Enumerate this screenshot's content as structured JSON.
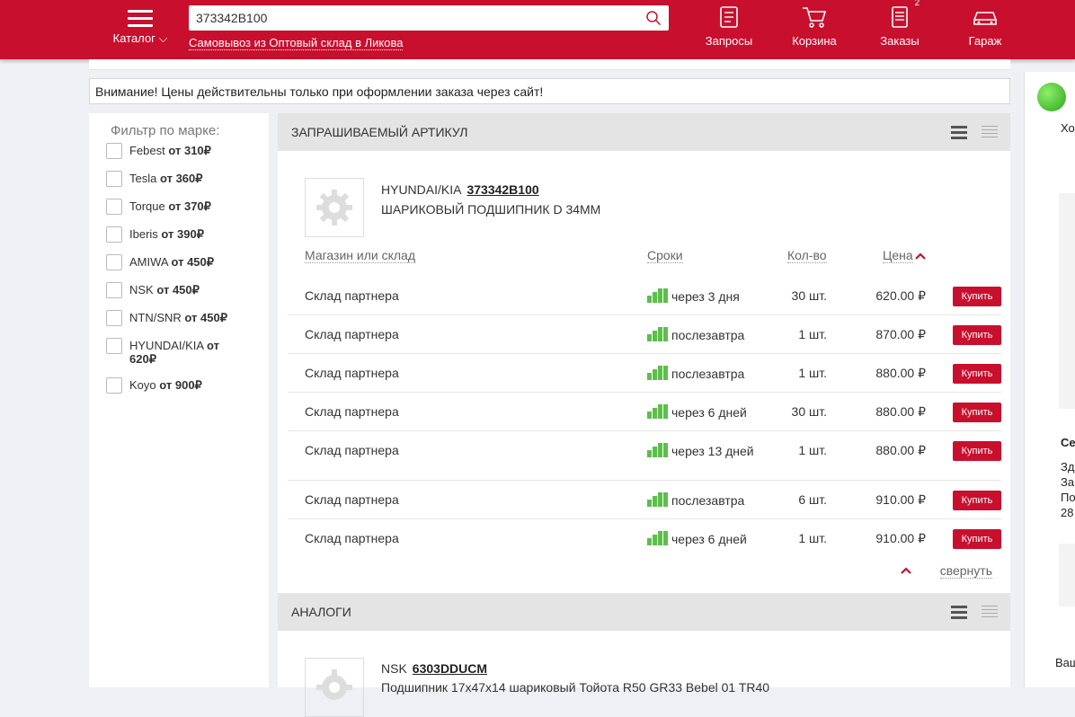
{
  "header": {
    "catalog_label": "Каталог ⌵",
    "search_value": "373342B100",
    "pickup": "Самовывоз из Оптовый склад в Ликова",
    "nav": [
      {
        "label": "Запросы",
        "icon": "checklist-icon"
      },
      {
        "label": "Корзина",
        "icon": "cart-icon"
      },
      {
        "label": "Заказы",
        "icon": "orders-icon",
        "badge": "2"
      },
      {
        "label": "Гараж",
        "icon": "car-icon"
      }
    ]
  },
  "notice": "Внимание! Цены действительны только при оформлении заказа через сайт!",
  "filter": {
    "title": "Фильтр по марке:",
    "brands": [
      {
        "name": "Febest",
        "price": "от 310₽"
      },
      {
        "name": "Tesla",
        "price": "от 360₽"
      },
      {
        "name": "Torque",
        "price": "от 370₽"
      },
      {
        "name": "Iberis",
        "price": "от 390₽"
      },
      {
        "name": "AMIWA",
        "price": "от 450₽"
      },
      {
        "name": "NSK",
        "price": "от 450₽"
      },
      {
        "name": "NTN/SNR",
        "price": "от 450₽"
      },
      {
        "name": "HYUNDAI/KIA",
        "price": "от 620₽"
      },
      {
        "name": "Koyo",
        "price": "от 900₽"
      }
    ]
  },
  "requested": {
    "title": "ЗАПРАШИВАЕМЫЙ АРТИКУЛ",
    "brand": "HYUNDAI/KIA",
    "article": "373342B100",
    "description": "ШАРИКОВЫЙ ПОДШИПНИК D 34MM",
    "columns": {
      "store": "Магазин или склад",
      "term": "Сроки",
      "qty": "Кол-во",
      "price": "Цена"
    },
    "rows": [
      {
        "store": "Склад партнера",
        "term": "через 3 дня",
        "qty": "30 шт.",
        "price": "620.00 ₽",
        "buy": "Купить"
      },
      {
        "store": "Склад партнера",
        "term": "послезавтра",
        "qty": "1 шт.",
        "price": "870.00 ₽",
        "buy": "Купить"
      },
      {
        "store": "Склад партнера",
        "term": "послезавтра",
        "qty": "1 шт.",
        "price": "880.00 ₽",
        "buy": "Купить"
      },
      {
        "store": "Склад партнера",
        "term": "через 6 дней",
        "qty": "30 шт.",
        "price": "880.00 ₽",
        "buy": "Купить"
      },
      {
        "store": "Склад партнера",
        "term": "через 13 дней",
        "qty": "1 шт.",
        "price": "880.00 ₽",
        "buy": "Купить"
      },
      {
        "store": "Склад партнера",
        "term": "послезавтра",
        "qty": "6 шт.",
        "price": "910.00 ₽",
        "buy": "Купить"
      },
      {
        "store": "Склад партнера",
        "term": "через 6 дней",
        "qty": "1 шт.",
        "price": "910.00 ₽",
        "buy": "Купить"
      }
    ],
    "collapse": "свернуть"
  },
  "analogs": {
    "title": "АНАЛОГИ",
    "brand": "NSK",
    "article": "6303DDUCM",
    "description": "Подшипник 17x47x14 шариковый Тойота R50 GR33 Bebel 01 TR40"
  },
  "right_panel": {
    "t1": "Хо",
    "t2": "Се",
    "t3": "Зд",
    "t4": "За",
    "t5": "По",
    "t6": "28",
    "t7": "Ваш"
  },
  "colors": {
    "brand_red": "#c8102e",
    "availability_green": "#5cbf4a"
  }
}
